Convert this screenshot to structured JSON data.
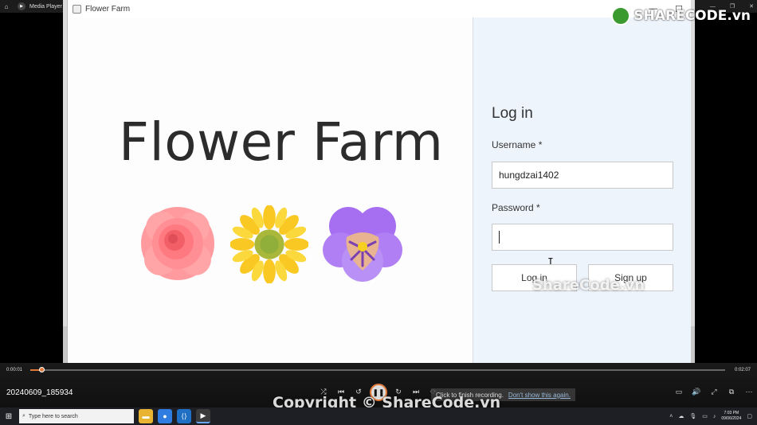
{
  "media_player": {
    "title": "Media Player",
    "elapsed": "0:00:01",
    "duration": "0:02:07",
    "progress_fraction": 0.01,
    "video_name": "20240609_185934",
    "accent_color": "#e07a3a"
  },
  "recording_toast": {
    "message": "Click to finish recording.",
    "dismiss_link": "Don't show this again."
  },
  "app": {
    "window_title": "Flower Farm",
    "brand_title": "Flower Farm",
    "flowers": [
      "rose-icon",
      "sunflower-icon",
      "pansy-icon"
    ]
  },
  "login": {
    "heading": "Log in",
    "username_label": "Username *",
    "username_value": "hungdzai1402",
    "password_label": "Password *",
    "password_value": "",
    "login_button": "Log in",
    "signup_button": "Sign up"
  },
  "watermarks": {
    "logo": "SHARECODE.vn",
    "middle": "ShareCode.vn",
    "bottom": "Copyright © ShareCode.vn"
  },
  "taskbar": {
    "search_placeholder": "Type here to search",
    "time": "7:03 PM",
    "date": "09/06/2024"
  }
}
